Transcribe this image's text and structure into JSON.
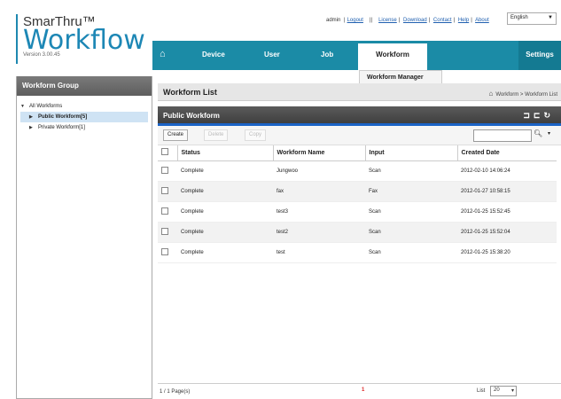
{
  "brand": {
    "name": "SmarThru™",
    "product": "Workflow",
    "version": "Version 3.00.45"
  },
  "toplinks": {
    "user": "admin",
    "logout": "Logout",
    "license": "License",
    "download": "Download",
    "contact": "Contact",
    "help": "Help",
    "about": "About"
  },
  "language": {
    "selected": "English"
  },
  "nav": {
    "items": [
      "Device",
      "User",
      "Job"
    ],
    "active": "Workform",
    "settings": "Settings",
    "submenu": "Workform Manager"
  },
  "left": {
    "title": "Workform Group",
    "tree": [
      {
        "label": "All Workforms"
      },
      {
        "label": "Public Workform[5]"
      },
      {
        "label": "Private Workform[1]"
      }
    ]
  },
  "main": {
    "title": "Workform List",
    "breadcrumb": "Workform > Workform List",
    "section": "Public Workform",
    "toolbar": {
      "create": "Create",
      "delete": "Delete",
      "copy": "Copy"
    },
    "columns": [
      "Status",
      "Workform Name",
      "Input",
      "Created Date"
    ],
    "rows": [
      {
        "status": "Complete",
        "name": "Jungwoo",
        "input": "Scan",
        "date": "2012-02-10 14:06:24"
      },
      {
        "status": "Complete",
        "name": "fax",
        "input": "Fax",
        "date": "2012-01-27 10:58:15"
      },
      {
        "status": "Complete",
        "name": "test3",
        "input": "Scan",
        "date": "2012-01-25 15:52:45"
      },
      {
        "status": "Complete",
        "name": "test2",
        "input": "Scan",
        "date": "2012-01-25 15:52:04"
      },
      {
        "status": "Complete",
        "name": "test",
        "input": "Scan",
        "date": "2012-01-25 15:38:20"
      }
    ],
    "footer": {
      "pages": "1 / 1 Page(s)",
      "list_label": "List",
      "list_size": "20"
    }
  },
  "icons": {
    "home": "home-icon",
    "search": "search-icon",
    "refresh": "refresh-icon",
    "collapse": "collapse-icon"
  },
  "colors": {
    "nav": "#1b8ba6",
    "accent": "#1b63c6",
    "brand": "#1d87b5"
  }
}
